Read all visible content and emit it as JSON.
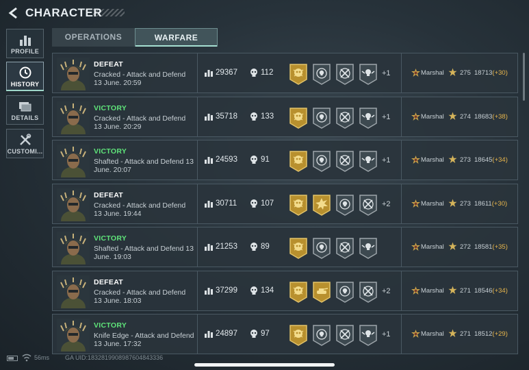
{
  "header": {
    "title": "CHARACTER"
  },
  "sidebar": {
    "items": [
      {
        "label": "PROFILE",
        "icon": "bar-chart-icon",
        "active": false
      },
      {
        "label": "HISTORY",
        "icon": "clock-icon",
        "active": true
      },
      {
        "label": "DETAILS",
        "icon": "folders-icon",
        "active": false
      },
      {
        "label": "CUSTOMI...",
        "icon": "tools-icon",
        "active": false
      }
    ]
  },
  "tabs": [
    {
      "label": "OPERATIONS",
      "active": false
    },
    {
      "label": "WARFARE",
      "active": true
    }
  ],
  "matches": [
    {
      "result": "DEFEAT",
      "mode": "Cracked - Attack and Defend",
      "time": "13 June. 20:59",
      "score": "29367",
      "kills": "112",
      "badges": [
        "gold-skull-badge",
        "gray-skull-target-badge",
        "gray-crossed-rifles-badge",
        "gray-skull-wings-badge"
      ],
      "more": "+1",
      "rank": "Marshal",
      "level": "275",
      "xp": "18713",
      "xp_gain": "(+30)"
    },
    {
      "result": "VICTORY",
      "mode": "Cracked - Attack and Defend",
      "time": "13 June. 20:29",
      "score": "35718",
      "kills": "133",
      "badges": [
        "gold-skull-badge",
        "gray-skull-target-badge",
        "gray-crossed-rifles-badge",
        "gray-skull-wings-badge"
      ],
      "more": "+1",
      "rank": "Marshal",
      "level": "274",
      "xp": "18683",
      "xp_gain": "(+38)"
    },
    {
      "result": "VICTORY",
      "mode": "Shafted - Attack and Defend",
      "time": "13 June. 20:07",
      "score": "24593",
      "kills": "91",
      "badges": [
        "gold-skull-badge",
        "gray-skull-target-badge",
        "gray-crossed-rifles-badge",
        "gray-skull-wings-badge"
      ],
      "more": "+1",
      "rank": "Marshal",
      "level": "273",
      "xp": "18645",
      "xp_gain": "(+34)"
    },
    {
      "result": "DEFEAT",
      "mode": "Cracked - Attack and Defend",
      "time": "13 June. 19:44",
      "score": "30711",
      "kills": "107",
      "badges": [
        "gold-skull-badge",
        "gold-explosion-badge",
        "gray-skull-target-badge",
        "gray-crossed-rifles-badge"
      ],
      "more": "+2",
      "rank": "Marshal",
      "level": "273",
      "xp": "18611",
      "xp_gain": "(+30)"
    },
    {
      "result": "VICTORY",
      "mode": "Shafted - Attack and Defend",
      "time": "13 June. 19:03",
      "score": "21253",
      "kills": "89",
      "badges": [
        "gold-skull-badge",
        "gray-skull-target-badge",
        "gray-crossed-rifles-badge",
        "gray-skull-wings-badge"
      ],
      "more": "",
      "rank": "Marshal",
      "level": "272",
      "xp": "18581",
      "xp_gain": "(+35)"
    },
    {
      "result": "DEFEAT",
      "mode": "Cracked - Attack and Defend",
      "time": "13 June. 18:03",
      "score": "37299",
      "kills": "134",
      "badges": [
        "gold-skull-badge",
        "gold-tank-badge",
        "gray-skull-target-badge",
        "gray-crossed-rifles-badge"
      ],
      "more": "+2",
      "rank": "Marshal",
      "level": "271",
      "xp": "18546",
      "xp_gain": "(+34)"
    },
    {
      "result": "VICTORY",
      "mode": "Knife Edge - Attack and Defend",
      "time": "13 June. 17:32",
      "score": "24897",
      "kills": "97",
      "badges": [
        "gold-skull-badge",
        "gray-skull-target-badge",
        "gray-crossed-rifles-badge",
        "gray-skull-wings-badge"
      ],
      "more": "+1",
      "rank": "Marshal",
      "level": "271",
      "xp": "18512",
      "xp_gain": "(+29)"
    }
  ],
  "footer": {
    "ping": "56ms",
    "uid": "GA UID:1832819908987604843336"
  },
  "colors": {
    "victory": "#5fe57a",
    "defeat": "#ffffff",
    "xp_gain": "#e8b64c",
    "gold_badge": "#b8902e",
    "gray_badge": "#9ea6ab"
  }
}
